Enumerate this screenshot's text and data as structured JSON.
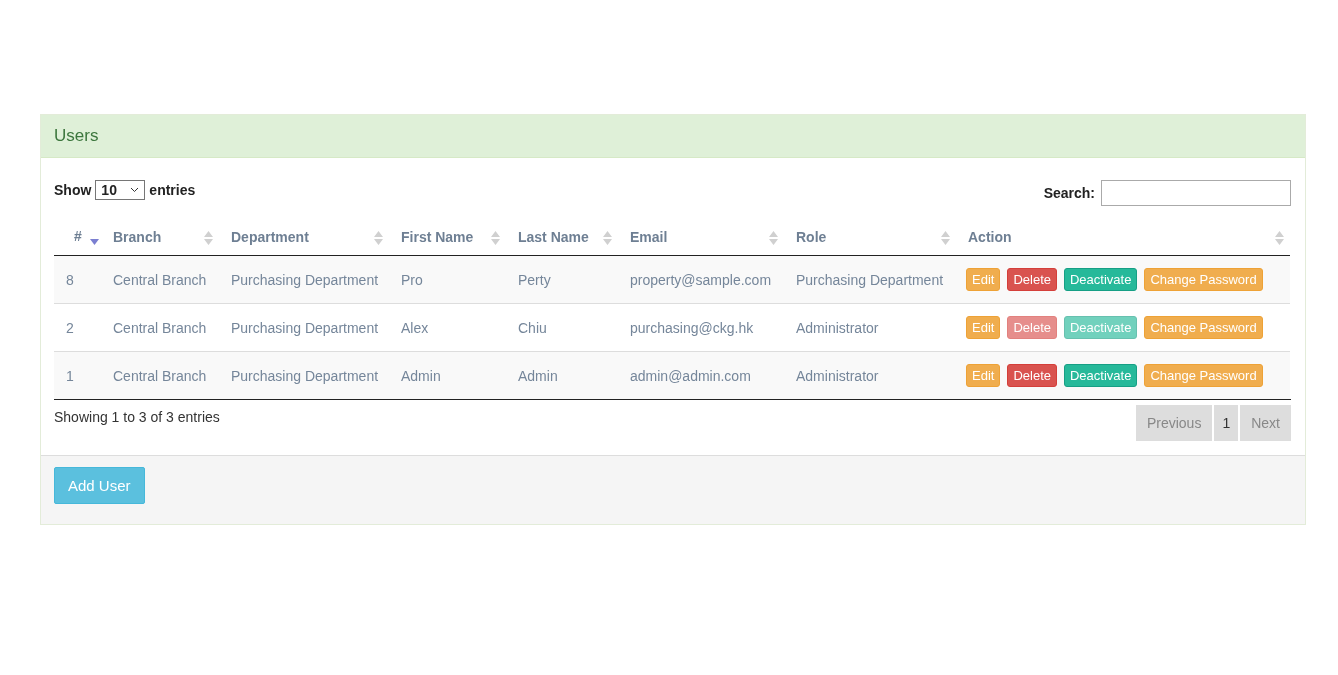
{
  "panel": {
    "title": "Users"
  },
  "length": {
    "show_label": "Show",
    "value": "10",
    "entries_label": "entries"
  },
  "search": {
    "label": "Search:"
  },
  "columns": [
    {
      "label": "#",
      "sorted": true
    },
    {
      "label": "Branch",
      "sorted": false
    },
    {
      "label": "Department",
      "sorted": false
    },
    {
      "label": "First Name",
      "sorted": false
    },
    {
      "label": "Last Name",
      "sorted": false
    },
    {
      "label": "Email",
      "sorted": false
    },
    {
      "label": "Role",
      "sorted": false
    },
    {
      "label": "Action",
      "sorted": false
    }
  ],
  "rows": [
    {
      "cells": [
        "8",
        "Central Branch",
        "Purchasing Department",
        "Pro",
        "Perty",
        "property@sample.com",
        "Purchasing Department"
      ],
      "actions": [
        {
          "kind": "edit",
          "label": "Edit",
          "disabled": false
        },
        {
          "kind": "delete",
          "label": "Delete",
          "disabled": false
        },
        {
          "kind": "deactivate",
          "label": "Deactivate",
          "disabled": false
        },
        {
          "kind": "password",
          "label": "Change Password",
          "disabled": false
        }
      ]
    },
    {
      "cells": [
        "2",
        "Central Branch",
        "Purchasing Department",
        "Alex",
        "Chiu",
        "purchasing@ckg.hk",
        "Administrator"
      ],
      "actions": [
        {
          "kind": "edit",
          "label": "Edit",
          "disabled": false
        },
        {
          "kind": "delete",
          "label": "Delete",
          "disabled": true
        },
        {
          "kind": "deactivate",
          "label": "Deactivate",
          "disabled": true
        },
        {
          "kind": "password",
          "label": "Change Password",
          "disabled": false
        }
      ]
    },
    {
      "cells": [
        "1",
        "Central Branch",
        "Purchasing Department",
        "Admin",
        "Admin",
        "admin@admin.com",
        "Administrator"
      ],
      "actions": [
        {
          "kind": "edit",
          "label": "Edit",
          "disabled": false
        },
        {
          "kind": "delete",
          "label": "Delete",
          "disabled": false
        },
        {
          "kind": "deactivate",
          "label": "Deactivate",
          "disabled": false
        },
        {
          "kind": "password",
          "label": "Change Password",
          "disabled": false
        }
      ]
    }
  ],
  "info": "Showing 1 to 3 of 3 entries",
  "pagination": [
    {
      "label": "Previous",
      "selected": false
    },
    {
      "label": "1",
      "selected": true
    },
    {
      "label": "Next",
      "selected": false
    }
  ],
  "add_button": "Add User"
}
